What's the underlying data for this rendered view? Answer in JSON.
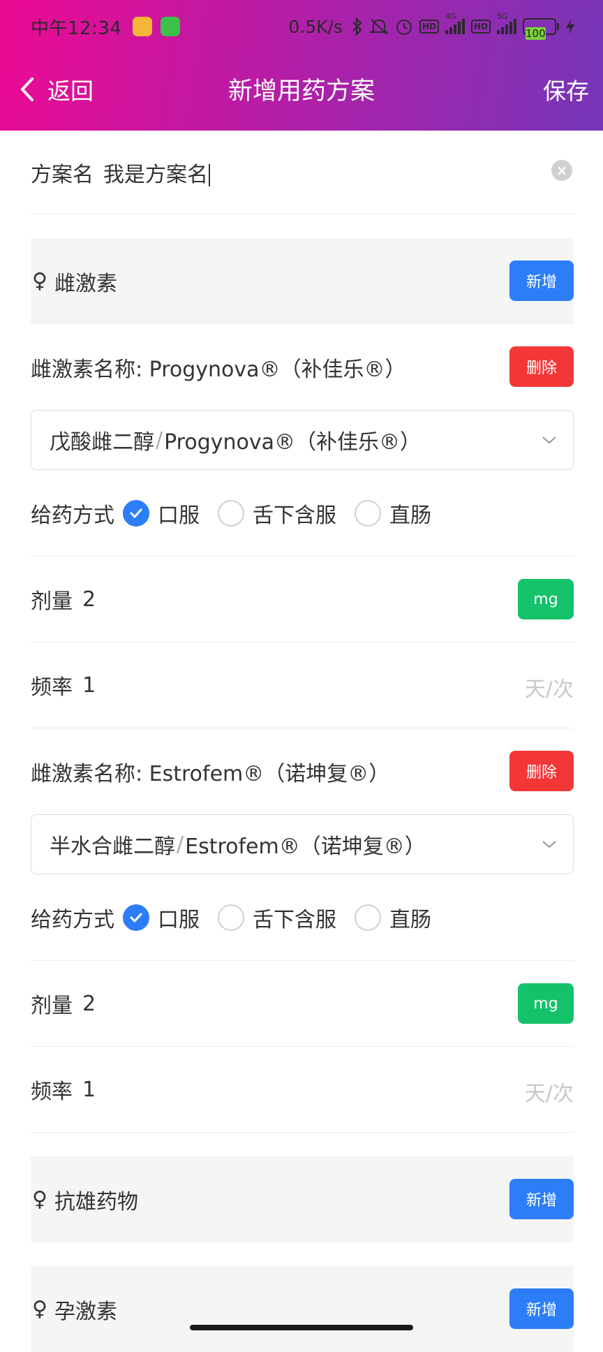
{
  "status": {
    "time": "中午12:34",
    "speed": "0.5K/s",
    "battery": "100",
    "net1": "4G",
    "net2": "5G",
    "hd": "HD"
  },
  "nav": {
    "back_label": "返回",
    "title": "新增用药方案",
    "save_label": "保存"
  },
  "plan": {
    "label": "方案名",
    "value": "我是方案名"
  },
  "sections": {
    "estrogen": {
      "symbol": "♀",
      "title": "雌激素",
      "add_label": "新增"
    },
    "antiandrogen": {
      "symbol": "♀",
      "title": "抗雄药物",
      "add_label": "新增"
    },
    "progestin": {
      "symbol": "♀",
      "title": "孕激素",
      "add_label": "新增"
    }
  },
  "drugs": [
    {
      "name_label": "雌激素名称: Progynova®（补佳乐®）",
      "delete_label": "删除",
      "select_generic": "戊酸雌二醇",
      "select_brand": "Progynova®（补佳乐®）",
      "route_label": "给药方式",
      "routes": [
        "口服",
        "舌下含服",
        "直肠"
      ],
      "route_selected": "口服",
      "dose_label": "剂量",
      "dose_value": "2",
      "dose_unit": "mg",
      "freq_label": "频率",
      "freq_value": "1",
      "freq_unit": "天/次"
    },
    {
      "name_label": "雌激素名称: Estrofem®（诺坤复®）",
      "delete_label": "删除",
      "select_generic": "半水合雌二醇",
      "select_brand": "Estrofem®（诺坤复®）",
      "route_label": "给药方式",
      "routes": [
        "口服",
        "舌下含服",
        "直肠"
      ],
      "route_selected": "口服",
      "dose_label": "剂量",
      "dose_value": "2",
      "dose_unit": "mg",
      "freq_label": "频率",
      "freq_value": "1",
      "freq_unit": "天/次"
    }
  ],
  "colors": {
    "header_start": "#ec0a93",
    "header_end": "#7536b8",
    "primary": "#2c7ef8",
    "danger": "#f33737",
    "success": "#14c26a"
  }
}
